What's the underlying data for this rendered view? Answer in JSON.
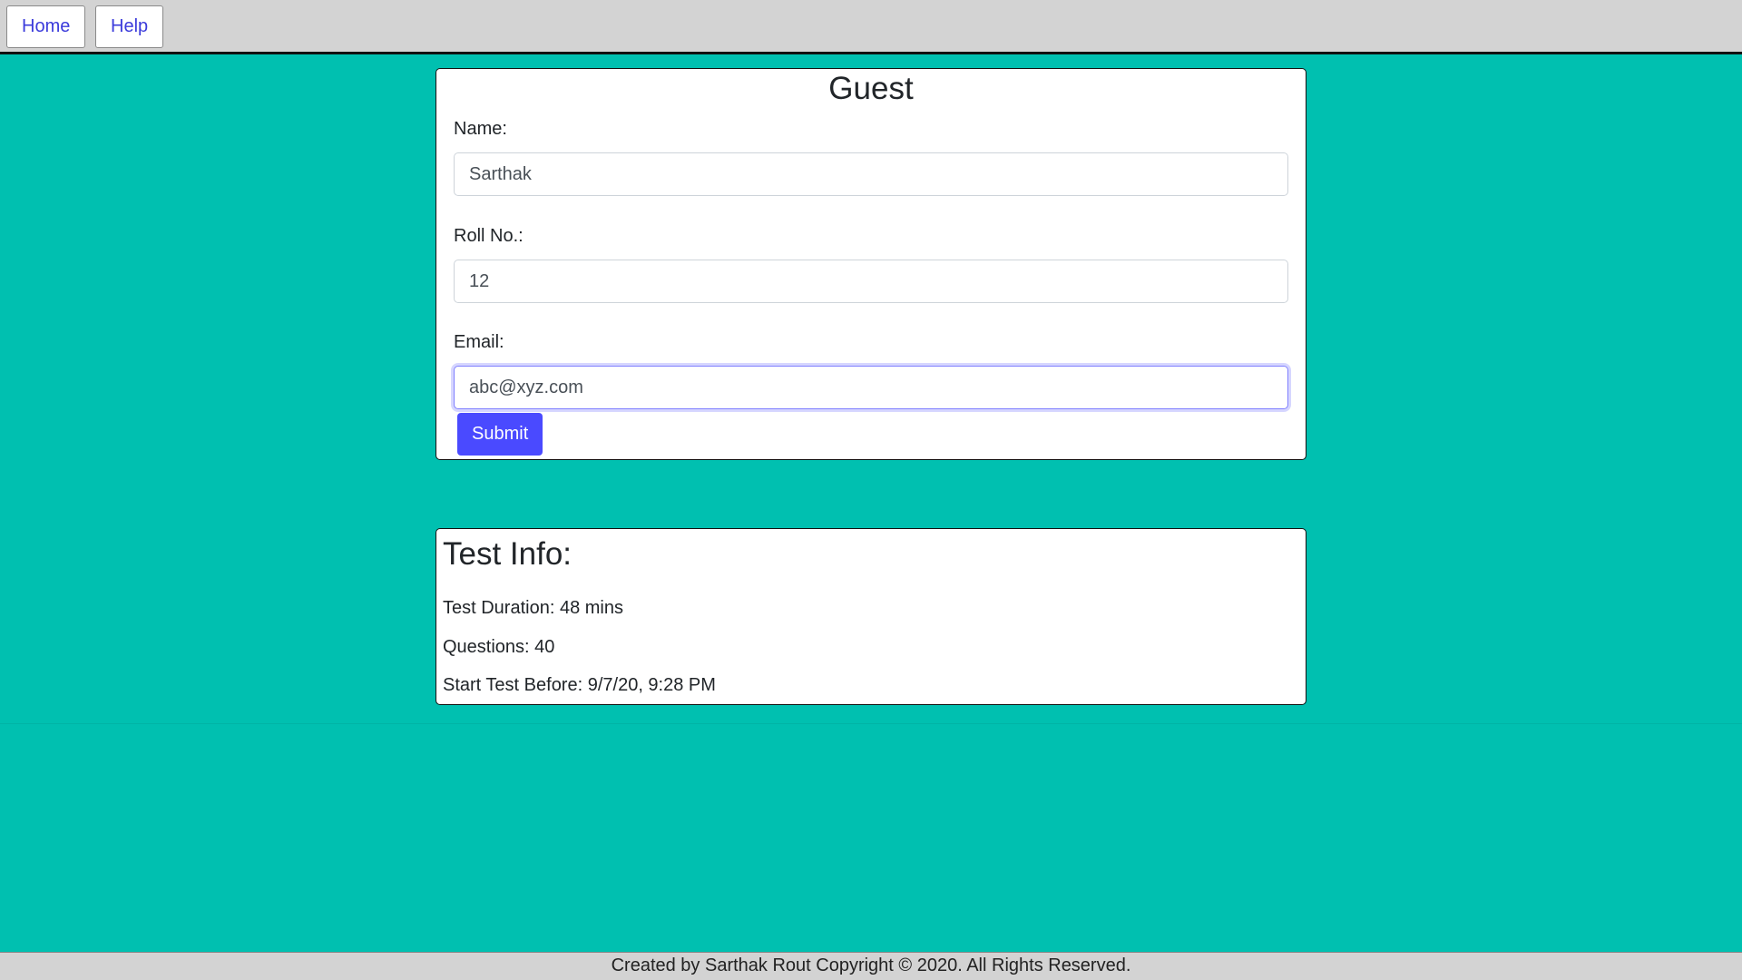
{
  "nav": {
    "home_label": "Home",
    "help_label": "Help"
  },
  "guest": {
    "title": "Guest",
    "name_label": "Name:",
    "name_value": "Sarthak",
    "roll_label": "Roll No.:",
    "roll_value": "12",
    "email_label": "Email:",
    "email_value": "abc@xyz.com",
    "submit_label": "Submit"
  },
  "test_info": {
    "title": "Test Info:",
    "duration": "Test Duration: 48 mins",
    "questions": "Questions: 40",
    "start_before": "Start Test Before: 9/7/20, 9:28 PM"
  },
  "footer": {
    "text": "Created by Sarthak Rout Copyright © 2020. All Rights Reserved."
  },
  "colors": {
    "background": "#00c0b0",
    "nav_bar": "#d3d3d3",
    "link": "#3b3bdb",
    "primary_button": "#4a4aff"
  }
}
